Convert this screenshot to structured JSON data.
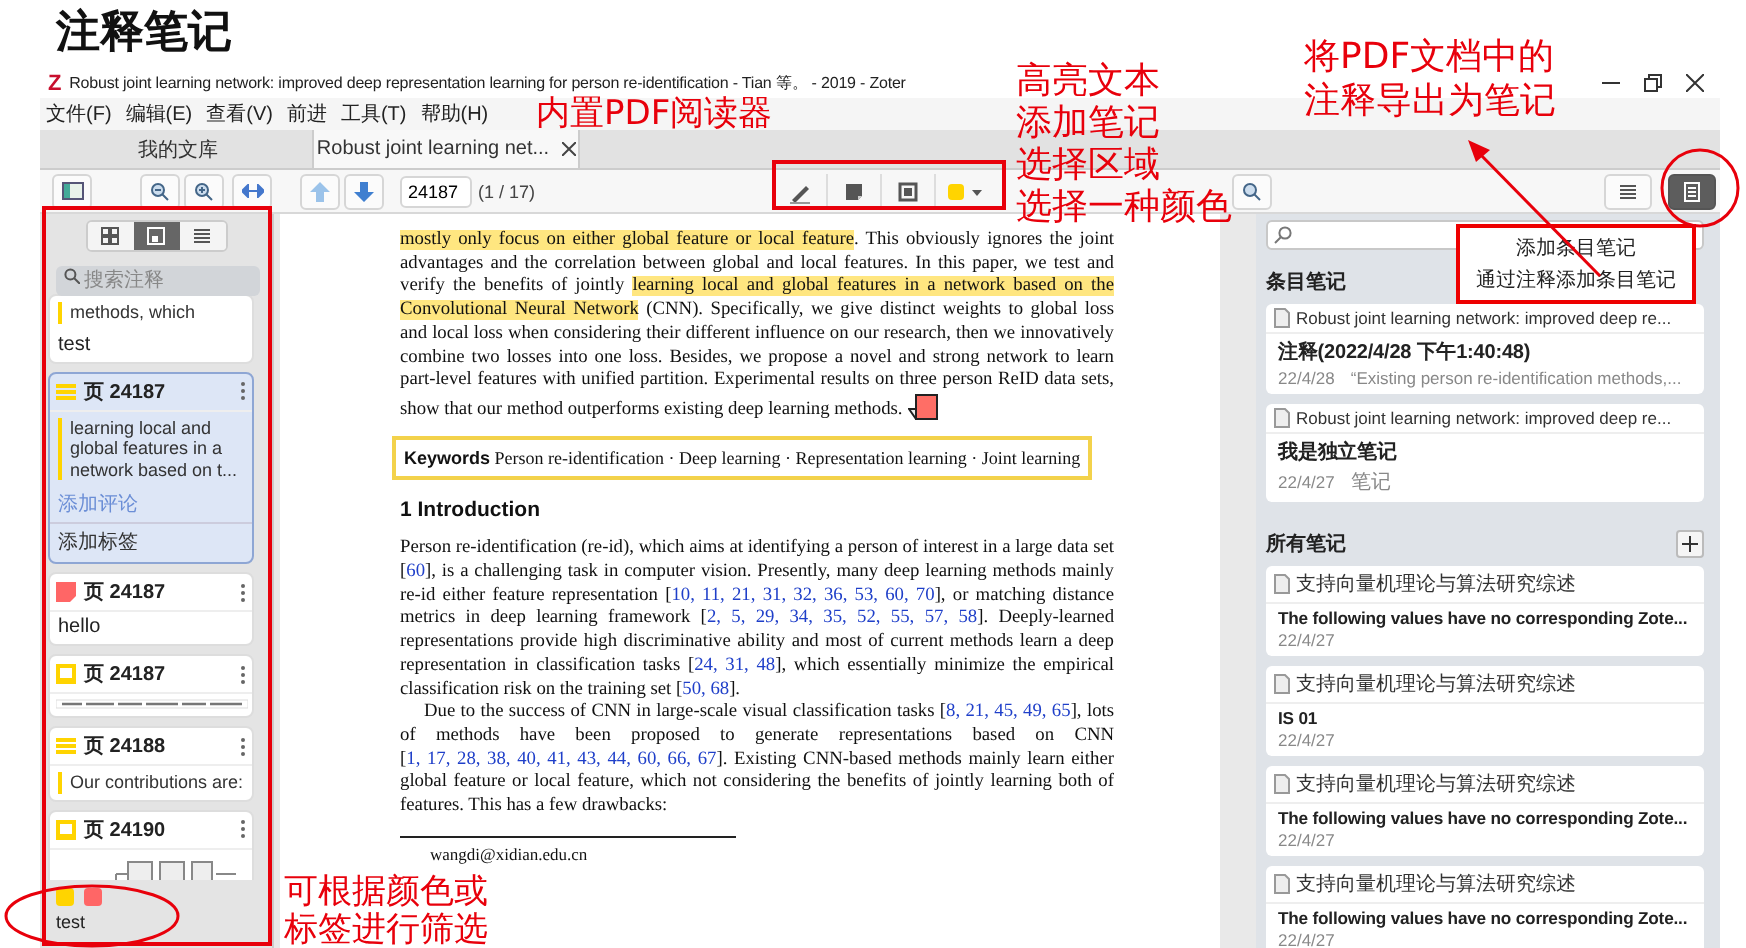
{
  "slide_title": "注释笔记",
  "window": {
    "logo": "Z",
    "title": "Robust joint learning network: improved deep representation learning for person re-identification - Tian 等。 - 2019 - Zoter"
  },
  "menu": [
    "文件(F)",
    "编辑(E)",
    "查看(V)",
    "前进",
    "工具(T)",
    "帮助(H)"
  ],
  "tabs": [
    {
      "label": "我的文库",
      "selected": false,
      "closable": false
    },
    {
      "label": "Robust joint learning net...",
      "selected": true,
      "closable": true
    }
  ],
  "toolbar": {
    "page": "24187",
    "page_count": "(1 / 17)",
    "tools": [
      {
        "kind": "highlight",
        "selected": false
      },
      {
        "kind": "note",
        "selected": false
      },
      {
        "kind": "area",
        "selected": false
      }
    ],
    "panes": [
      {
        "kind": "outline",
        "selected": false
      },
      {
        "kind": "notes",
        "selected": true
      }
    ]
  },
  "sidebar": {
    "views": [
      {
        "kind": "thumbnails",
        "selected": false
      },
      {
        "kind": "annotations",
        "selected": true
      },
      {
        "kind": "outline",
        "selected": false
      }
    ],
    "search": {
      "placeholder": "搜索注释"
    },
    "annotations": [
      {
        "kind": "highlight",
        "color": "#ffd400",
        "text": "methods, which",
        "comment": "test",
        "selected": false
      },
      {
        "kind": "highlight",
        "color": "#ffd400",
        "page": "页 24187",
        "text": "learning local and global features in a network based on t...",
        "comment_placeholder": "添加评论",
        "tags_placeholder": "添加标签",
        "selected": true
      },
      {
        "kind": "note",
        "color": "#ff6666",
        "page": "页 24187",
        "comment": "hello",
        "selected": false
      },
      {
        "kind": "image",
        "color": "#ffd400",
        "page": "页 24187",
        "thumbnail": {
          "kind": "text"
        },
        "selected": false
      },
      {
        "kind": "highlight",
        "color": "#ffd400",
        "page": "页 24188",
        "text": "Our contributions are:",
        "selected": false
      },
      {
        "kind": "image",
        "color": "#ffd400",
        "page": "页 24190",
        "thumbnail": {
          "kind": "figure"
        },
        "selected": false
      }
    ],
    "filter": {
      "colors": [
        {
          "color": "#ffd400"
        },
        {
          "color": "#ff6666"
        }
      ],
      "tags": [
        "test"
      ]
    }
  },
  "pdf": {
    "abstract": [
      {
        "kind": "highlight",
        "text": "mostly only focus on either global feature or local feature"
      },
      {
        "kind": "plain",
        "text": ". This obviously ignores the joint advantages and the correlation between global and local features. In this paper, we test and verify the benefits of jointly "
      },
      {
        "kind": "highlight",
        "text": "learning local and global features in a network based on the Convolutional Neural Network"
      },
      {
        "kind": "plain",
        "text": " (CNN). Specifically, we give distinct weights to global loss and local loss when considering their different influence on our research, then we innovatively combine two losses into one loss. Besides, we propose a novel and strong network to learn part-level features with unified partition. Experimental results on three person ReID data sets, show that our method outperforms existing deep learning methods."
      }
    ],
    "keywords": "**Keywords** Person re-identification · Deep learning · Representation learning · Joint learning",
    "section_heading": "1 Introduction",
    "paragraphs": [
      [
        {
          "kind": "plain",
          "text": "Person re-identification (re-id), which aims at identifying a person of interest in a large data set ["
        },
        {
          "kind": "cite",
          "text": "60"
        },
        {
          "kind": "plain",
          "text": "], is a challenging task in computer vision. Presently, many deep learning methods mainly re-id either feature representation ["
        },
        {
          "kind": "cite",
          "text": "10, 11, 21, 31, 32, 36, 53, 60, 70"
        },
        {
          "kind": "plain",
          "text": "], or matching distance metrics in deep learning framework ["
        },
        {
          "kind": "cite",
          "text": "2, 5, 29, 34, 35, 52, 55, 57, 58"
        },
        {
          "kind": "plain",
          "text": "]. Deeply-learned representations provide high discriminative ability and most of current methods learn a deep representation in classification tasks ["
        },
        {
          "kind": "cite",
          "text": "24, 31, 48"
        },
        {
          "kind": "plain",
          "text": "], which essentially minimize the empirical classification risk on the training set ["
        },
        {
          "kind": "cite",
          "text": "50, 68"
        },
        {
          "kind": "plain",
          "text": "]."
        }
      ],
      [
        {
          "kind": "plain",
          "text": "Due to the success of CNN in large-scale visual classification tasks ["
        },
        {
          "kind": "cite",
          "text": "8, 21, 45, 49, 65"
        },
        {
          "kind": "plain",
          "text": "], lots of methods have been proposed to generate representations based on CNN ["
        },
        {
          "kind": "cite",
          "text": "1, 17, 28, 38, 40, 41, 43, 44, 60, 66, 67"
        },
        {
          "kind": "plain",
          "text": "]. Existing CNN-based methods mainly learn either global feature or local feature, which not considering the benefits of jointly learning both of features. This has a few drawbacks:"
        }
      ]
    ],
    "footnote": "wangdi@xidian.edu.cn"
  },
  "notes_panel": {
    "add_menu": [
      "添加条目笔记",
      "通过注释添加条目笔记"
    ],
    "item_notes": {
      "heading": "条目笔记",
      "notes": [
        {
          "parent": "Robust joint learning network: improved deep re...",
          "title": "注释(2022/4/28 下午1:40:48)",
          "date": "22/4/28",
          "preview": "“Existing person re-identification methods,..."
        },
        {
          "parent": "Robust joint learning network: improved deep re...",
          "title": "我是独立笔记",
          "date": "22/4/27",
          "preview": "笔记"
        }
      ]
    },
    "all_notes": {
      "heading": "所有笔记",
      "notes": [
        {
          "parent": "支持向量机理论与算法研究综述",
          "title": "The following values have no corresponding Zote...",
          "date": "22/4/27"
        },
        {
          "parent": "支持向量机理论与算法研究综述",
          "title": "IS 01",
          "date": "22/4/27"
        },
        {
          "parent": "支持向量机理论与算法研究综述",
          "title": "The following values have no corresponding Zote...",
          "date": "22/4/27"
        },
        {
          "parent": "支持向量机理论与算法研究综述",
          "title": "The following values have no corresponding Zote...",
          "date": "22/4/27"
        }
      ]
    }
  },
  "callouts": [
    {
      "lines": [
        "内置PDF阅读器"
      ]
    },
    {
      "lines": [
        "高亮文本",
        "添加笔记",
        "选择区域",
        "选择一种颜色"
      ]
    },
    {
      "lines": [
        "将PDF文档中的",
        "注释导出为笔记"
      ]
    },
    {
      "lines": [
        "可根据颜色或",
        "标签进行筛选"
      ]
    }
  ]
}
